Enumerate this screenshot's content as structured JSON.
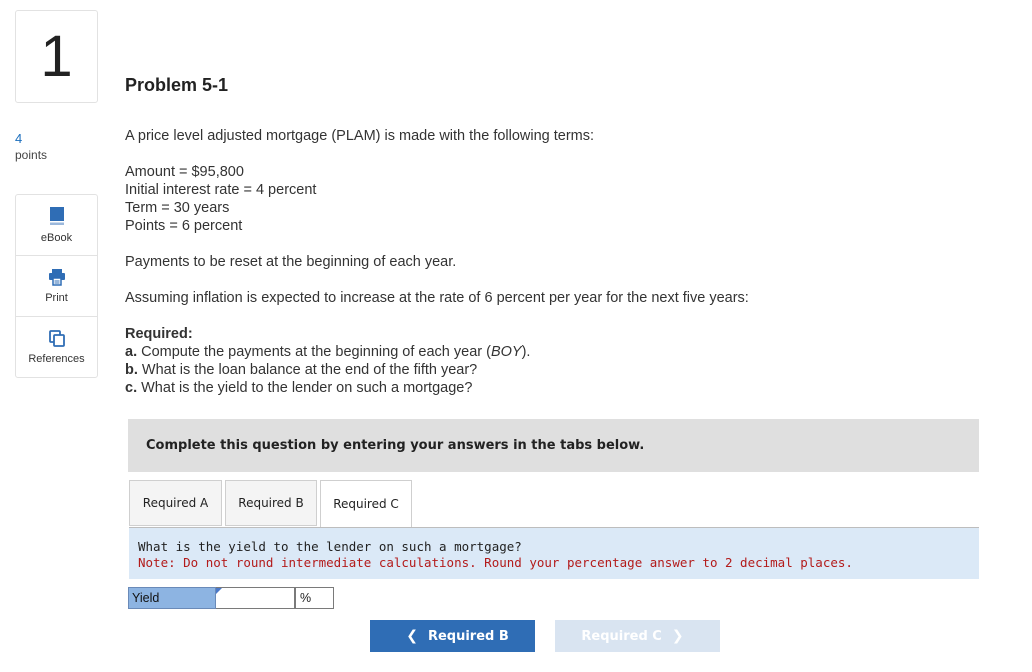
{
  "question_number": "1",
  "points": {
    "value": "4",
    "label": "points"
  },
  "tools": [
    {
      "label": "eBook",
      "icon": "book-icon"
    },
    {
      "label": "Print",
      "icon": "printer-icon"
    },
    {
      "label": "References",
      "icon": "copy-icon"
    }
  ],
  "problem": {
    "title": "Problem 5-1",
    "intro": "A price level adjusted mortgage (PLAM) is made with the following terms:",
    "terms": [
      "Amount = $95,800",
      "Initial interest rate = 4 percent",
      "Term = 30 years",
      "Points = 6 percent"
    ],
    "reset": "Payments to be reset at the beginning of each year.",
    "inflation": "Assuming inflation is expected to increase at the rate of 6 percent per year for the next five years:",
    "required_heading": "Required:",
    "required": [
      {
        "letter": "a.",
        "pre": "Compute the payments at the beginning of each year (",
        "em": "BOY",
        "post": ")."
      },
      {
        "letter": "b.",
        "pre": "What is the loan balance at the end of the fifth year?",
        "em": "",
        "post": ""
      },
      {
        "letter": "c.",
        "pre": "What is the yield to the lender on such a mortgage?",
        "em": "",
        "post": ""
      }
    ]
  },
  "instruction": "Complete this question by entering your answers in the tabs below.",
  "tabs": [
    "Required A",
    "Required B",
    "Required C"
  ],
  "active_tab": "Required C",
  "panel": {
    "question": "What is the yield to the lender on such a mortgage?",
    "note": "Note: Do not round intermediate calculations. Round your percentage answer to 2 decimal places."
  },
  "answer": {
    "label": "Yield",
    "value": "",
    "unit": "%"
  },
  "nav": {
    "prev": "Required B",
    "next": "Required C"
  },
  "colors": {
    "accent": "#2f6db5",
    "panel_bg": "#dbe9f7",
    "note_red": "#b31b1b",
    "label_blue": "#8db4e2",
    "disabled_btn": "#d9e4f1"
  }
}
